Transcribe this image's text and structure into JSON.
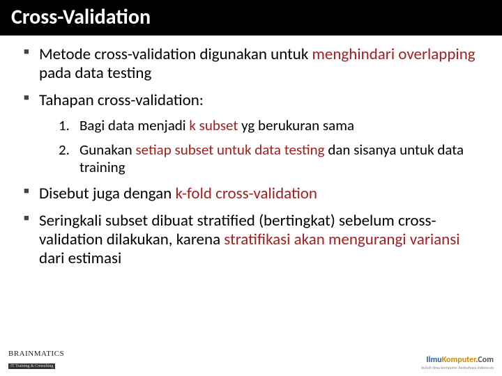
{
  "title": "Cross-Validation",
  "bullets": {
    "b1_p1": "Metode cross-validation digunakan untuk ",
    "b1_hl": "menghindari overlapping",
    "b1_p2": " pada data testing",
    "b2": "Tahapan cross-validation:",
    "s1_p1": "Bagi data menjadi ",
    "s1_hl": "k subset",
    "s1_p2": " yg berukuran sama",
    "s2_p1": "Gunakan ",
    "s2_hl": "setiap subset untuk data testing",
    "s2_p2": " dan sisanya untuk data training",
    "b3_p1": "Disebut juga dengan ",
    "b3_hl": "k-fold cross-validation",
    "b4_p1": "Seringkali subset dibuat stratified (bertingkat) sebelum cross-validation dilakukan, karena ",
    "b4_hl": "stratifikasi akan mengurangi variansi",
    "b4_p2": " dari estimasi"
  },
  "footer": {
    "left_brand": "BRAINMATICS",
    "left_sub": "IT Training & Consulting",
    "right_il": "Ilmu",
    "right_ko": "Komputer",
    "right_co": ".Com",
    "right_tag": "kuliah ilmu komputer berbahasa indonesia"
  }
}
